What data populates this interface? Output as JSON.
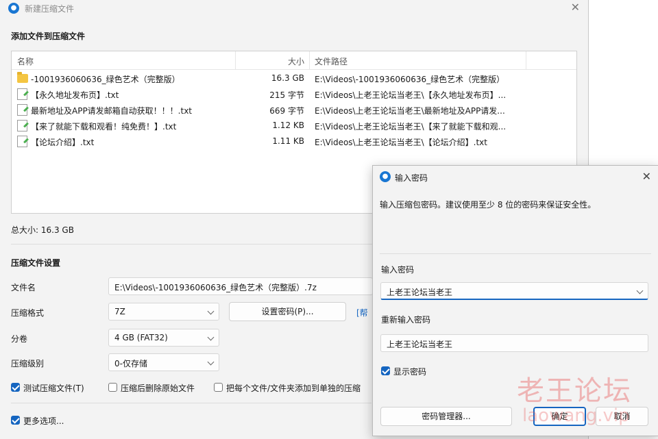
{
  "main_window": {
    "title": "新建压缩文件",
    "section_add": "添加文件到压缩文件",
    "columns": {
      "name": "名称",
      "size": "大小",
      "path": "文件路径"
    },
    "files": [
      {
        "icon": "folder-icon",
        "name": "-1001936060636_绿色艺术（完整版）",
        "size": "16.3 GB",
        "path": "E:\\Videos\\-1001936060636_绿色艺术（完整版）"
      },
      {
        "icon": "txt-file-icon",
        "name": "【永久地址发布页】.txt",
        "size": "215 字节",
        "path": "E:\\Videos\\上老王论坛当老王\\【永久地址发布页】..."
      },
      {
        "icon": "txt-file-icon",
        "name": "最新地址及APP请发邮箱自动获取！！！.txt",
        "size": "669 字节",
        "path": "E:\\Videos\\上老王论坛当老王\\最新地址及APP请发..."
      },
      {
        "icon": "txt-file-icon",
        "name": "【来了就能下载和观看！纯免费！】.txt",
        "size": "1.12 KB",
        "path": "E:\\Videos\\上老王论坛当老王\\【来了就能下载和观..."
      },
      {
        "icon": "txt-file-icon",
        "name": "【论坛介绍】.txt",
        "size": "1.11 KB",
        "path": "E:\\Videos\\上老王论坛当老王\\【论坛介绍】.txt"
      }
    ],
    "total_size": "总大小: 16.3 GB",
    "section_settings": "压缩文件设置",
    "filename_label": "文件名",
    "filename_value": "E:\\Videos\\-1001936060636_绿色艺术（完整版）.7z",
    "format_label": "压缩格式",
    "format_value": "7Z",
    "set_password_button": "设置密码(P)...",
    "help_link": "[帮",
    "split_label": "分卷",
    "split_value": "4 GB (FAT32)",
    "level_label": "压缩级别",
    "level_value": "0-仅存储",
    "test_checkbox": "测试压缩文件(T)",
    "delete_checkbox": "压缩后删除原始文件",
    "each_checkbox": "把每个文件/文件夹添加到单独的压缩",
    "more_options": "更多选项..."
  },
  "password_dialog": {
    "title": "输入密码",
    "hint": "输入压缩包密码。建议使用至少 8 位的密码来保证安全性。",
    "enter_label": "输入密码",
    "enter_value": "上老王论坛当老王",
    "reenter_label": "重新输入密码",
    "reenter_value": "上老王论坛当老王",
    "show_password": "显示密码",
    "manager_button": "密码管理器...",
    "ok_button": "确定",
    "cancel_button": "取消"
  },
  "watermark": {
    "text": "老王论坛",
    "url": "laowang.vip"
  }
}
